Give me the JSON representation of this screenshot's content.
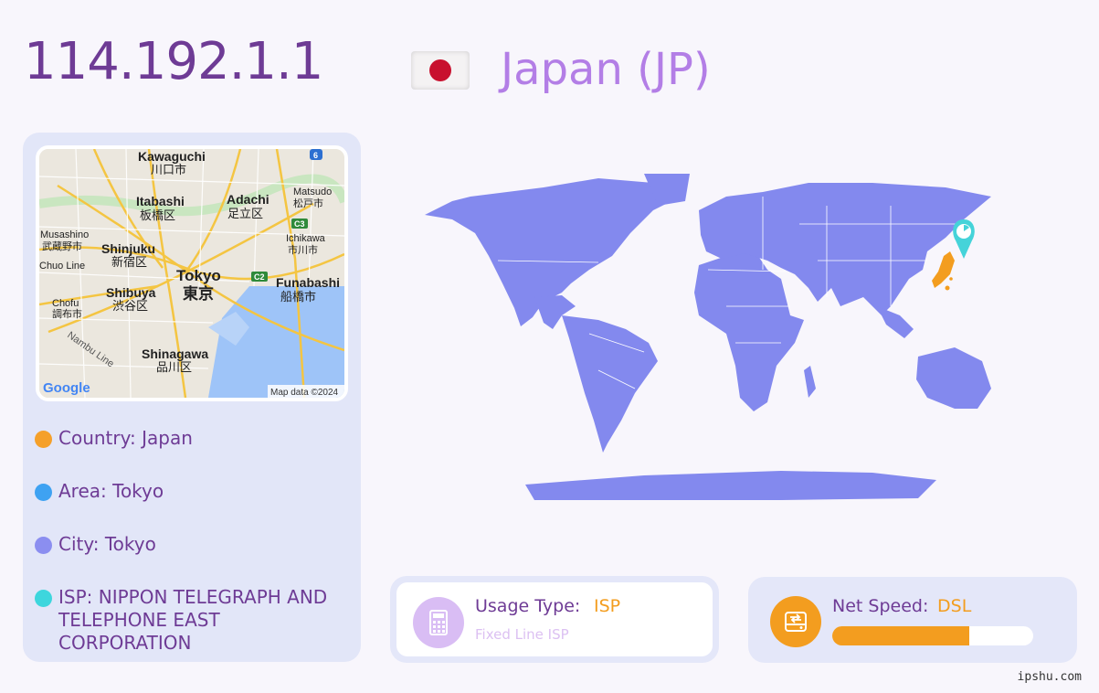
{
  "header": {
    "ip": "114.192.1.1",
    "country_title": "Japan (JP)"
  },
  "map_thumbnail": {
    "labels": {
      "kawaguchi": "Kawaguchi",
      "kawaguchi_jp": "川口市",
      "itabashi": "Itabashi",
      "itabashi_jp": "板橋区",
      "adachi": "Adachi",
      "adachi_jp": "足立区",
      "matsudo": "Matsudo",
      "matsudo_jp": "松戸市",
      "musashino": "Musashino",
      "musashino_jp": "武蔵野市",
      "shinjuku": "Shinjuku",
      "shinjuku_jp": "新宿区",
      "ichikawa": "Ichikawa",
      "ichikawa_jp": "市川市",
      "chuo_line": "Chuo Line",
      "tokyo": "Tokyo",
      "tokyo_jp": "東京",
      "funabashi": "Funabashi",
      "funabashi_jp": "船橋市",
      "shibuya": "Shibuya",
      "shibuya_jp": "渋谷区",
      "chofu": "Chofu",
      "chofu_jp": "調布市",
      "nambu_line": "Nambu Line",
      "shinagawa": "Shinagawa",
      "shinagawa_jp": "品川区",
      "badge_6": "6",
      "badge_c3": "C3",
      "badge_c2": "C2",
      "google": "Google",
      "map_data": "Map data ©2024"
    }
  },
  "info": [
    {
      "label": "Country: Japan",
      "color": "#f5a02a"
    },
    {
      "label": "Area: Tokyo",
      "color": "#3ea2f2"
    },
    {
      "label": "City: Tokyo",
      "color": "#8b8ef0"
    },
    {
      "label": "ISP: NIPPON TELEGRAPH AND TELEPHONE EAST CORPORATION",
      "color": "#3dd6dd"
    }
  ],
  "usage": {
    "label": "Usage Type:",
    "value": "ISP",
    "sub": "Fixed Line ISP",
    "icon": "fax-phone-icon"
  },
  "speed": {
    "label": "Net Speed:",
    "value": "DSL",
    "icon": "network-drive-icon",
    "level": 0.68
  },
  "watermark": "ipshu.com",
  "colors": {
    "ip_text": "#6e3b95",
    "country_text": "#b37ee6",
    "map_land": "#8389ee",
    "highlight": "#f39d1f",
    "marker": "#45d3d9"
  }
}
